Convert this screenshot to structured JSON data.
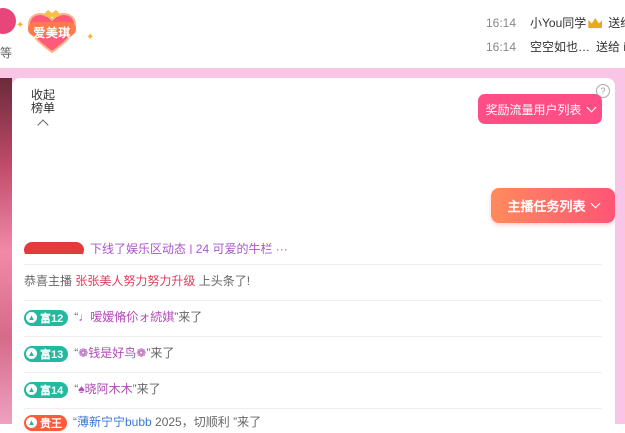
{
  "top": {
    "left_char": "等",
    "badge_label": "爱美琪",
    "feed": [
      {
        "time": "16:14",
        "name": "小You同学",
        "action": "送给"
      },
      {
        "time": "16:14",
        "name": "空空如也…",
        "action": "送给 i"
      }
    ]
  },
  "panel": {
    "collapse_label": "收起\n榜单",
    "help": "?",
    "reward_button": "奖励流量用户列表",
    "task_button": "主播任务列表"
  },
  "chat": {
    "cut_text": "下线了娱乐区动态 | 24 可爱的牛栏 ···",
    "messages": [
      {
        "prefix": "恭喜主播 ",
        "name": "张张美人努力努力升级",
        "suffix": " 上头条了!"
      },
      {
        "level": "富12",
        "quote_open": "“",
        "name": "♩嗳嫒脩伱ォ続娸",
        "suffix": "”来了"
      },
      {
        "level": "富13",
        "quote_open": "“",
        "name": "❁钱是好鸟❁",
        "suffix": "”来了"
      },
      {
        "level": "富14",
        "quote_open": "“",
        "name": "♠晓阿木木",
        "suffix": "”来了"
      },
      {
        "level": "贵王",
        "quote_open": "“",
        "name": "薄新宁宁bubb",
        "suffix": " 2025，切顺利 ”来了"
      }
    ]
  },
  "colors": {
    "accent_pink": "#ff4d86",
    "frame_pink": "#f9c5e6",
    "level_teal": "#23b8a0"
  }
}
